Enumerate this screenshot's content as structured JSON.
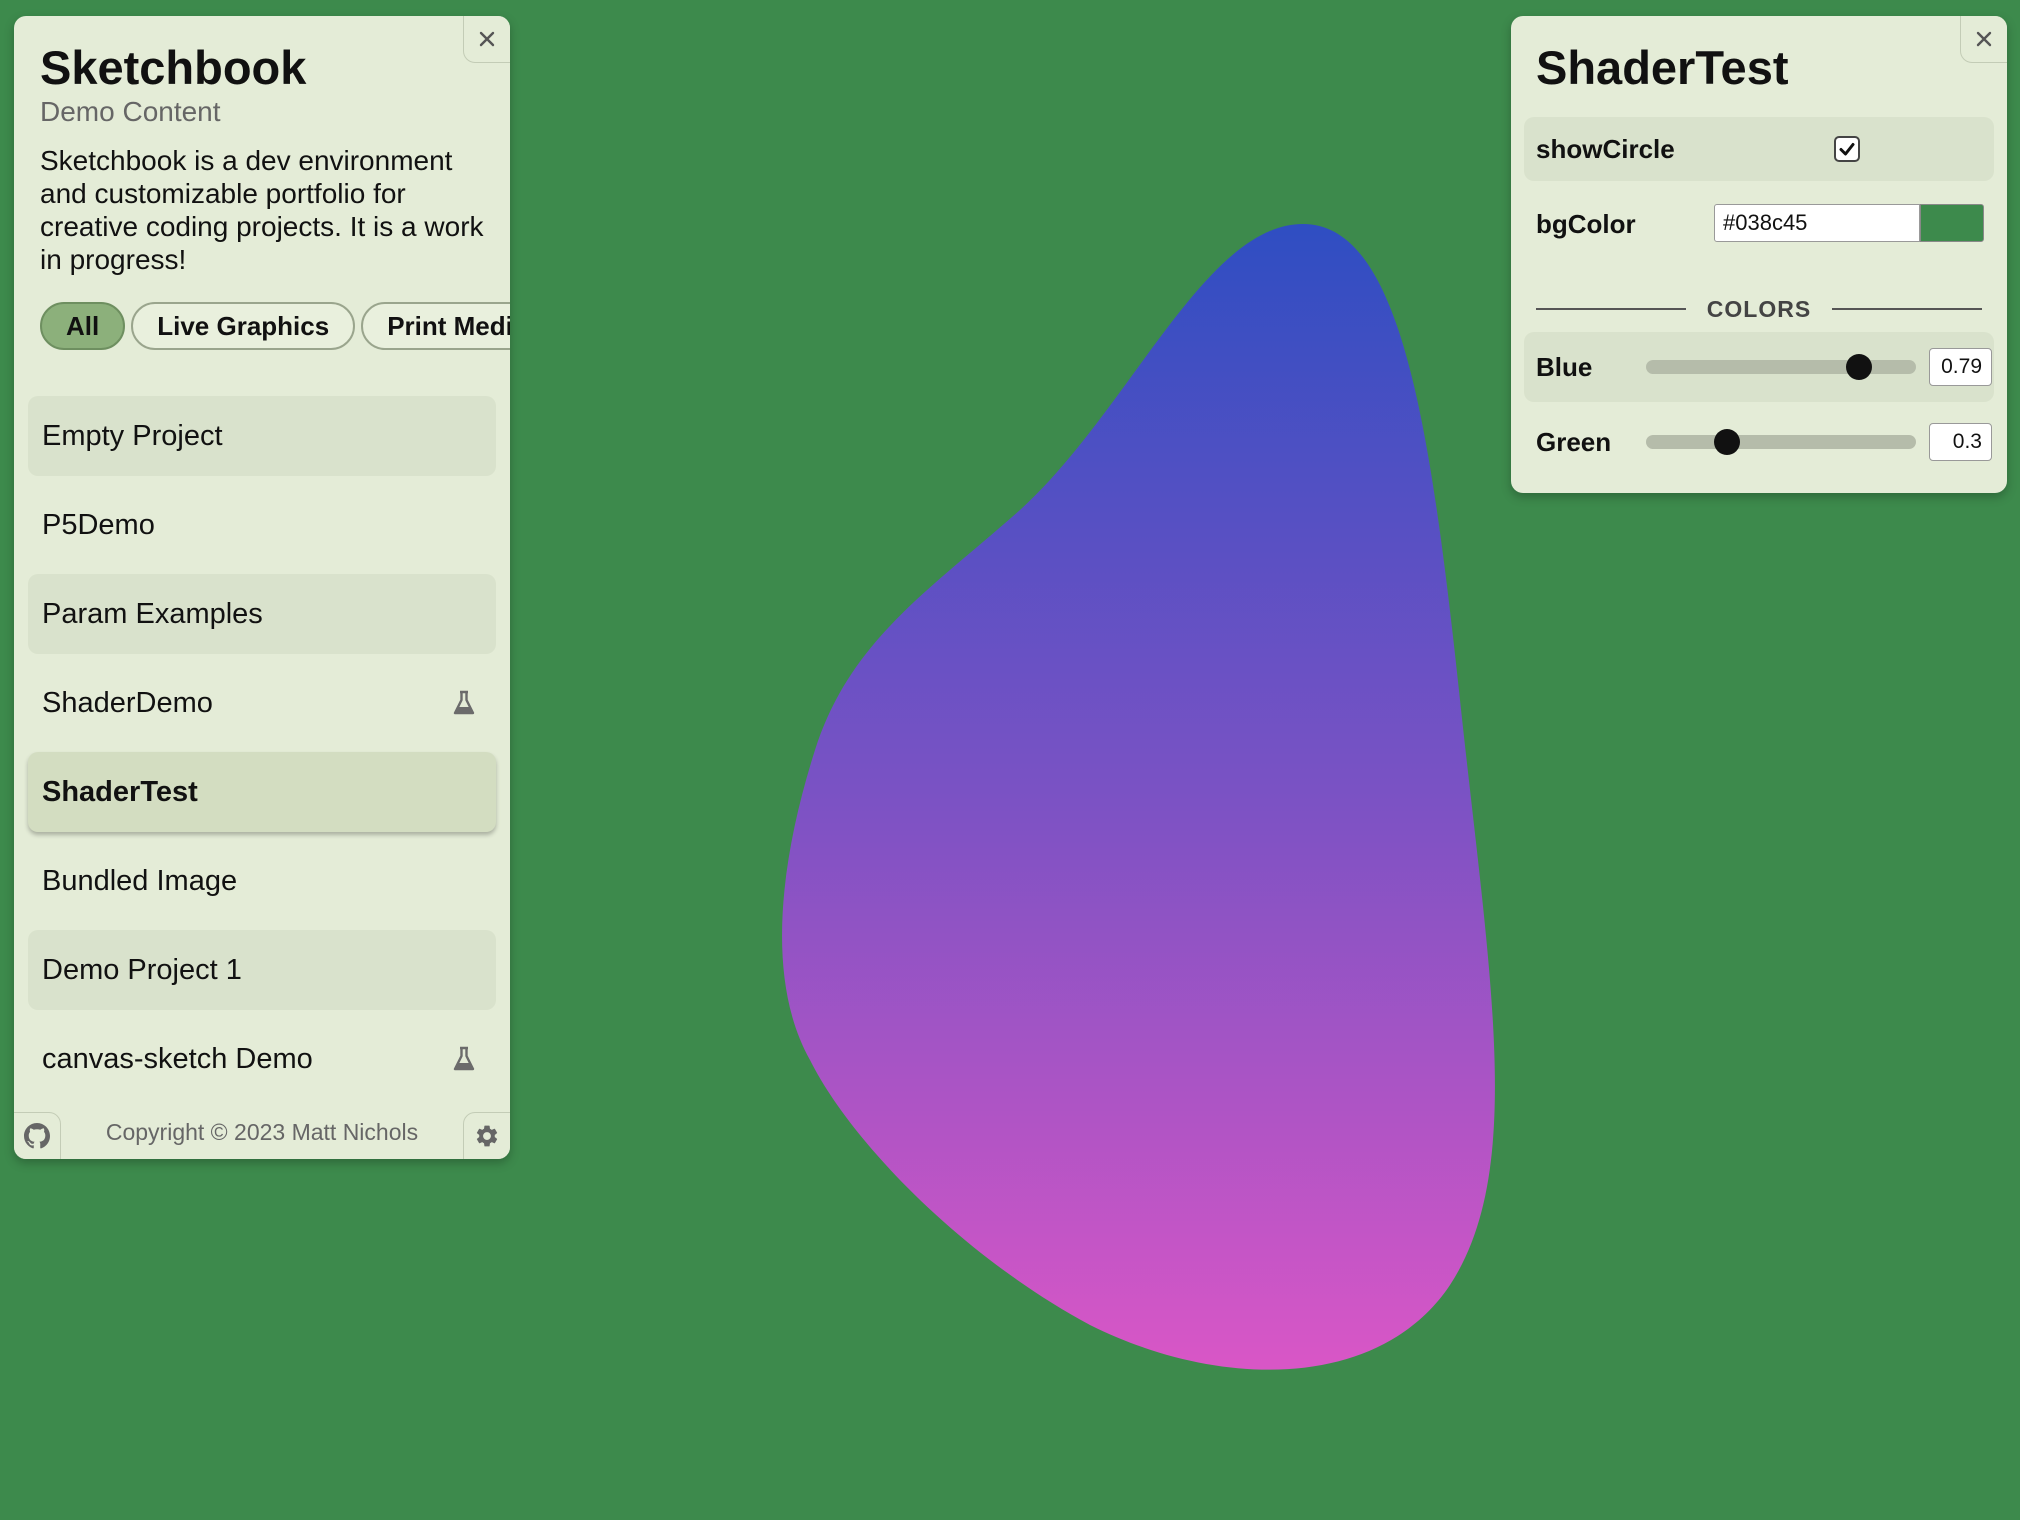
{
  "canvas": {
    "background_color": "#3d8a4c",
    "blob_gradient_top": "#2f4ec2",
    "blob_gradient_mid": "#7b52c4",
    "blob_gradient_bottom": "#d956c6"
  },
  "sidebar": {
    "title": "Sketchbook",
    "subtitle": "Demo Content",
    "description": "Sketchbook is a dev environment and customizable portfolio for creative coding projects. It is a work in progress!",
    "filters": [
      {
        "label": "All",
        "active": true
      },
      {
        "label": "Live Graphics",
        "active": false
      },
      {
        "label": "Print Media",
        "active": false
      }
    ],
    "projects": [
      {
        "label": "Empty Project"
      },
      {
        "label": "P5Demo"
      },
      {
        "label": "Param Examples"
      },
      {
        "label": "ShaderDemo",
        "icon": "flask-icon"
      },
      {
        "label": "ShaderTest",
        "selected": true
      },
      {
        "label": "Bundled Image"
      },
      {
        "label": "Demo Project 1"
      },
      {
        "label": "canvas-sketch Demo",
        "icon": "flask-icon"
      }
    ],
    "copyright": "Copyright © 2023 Matt Nichols",
    "icons": [
      "close-icon",
      "github-icon",
      "gear-icon"
    ]
  },
  "params_panel": {
    "title": "ShaderTest",
    "showCircle": {
      "label": "showCircle",
      "checked": true
    },
    "bgColor": {
      "label": "bgColor",
      "value": "#038c45",
      "swatch": "#3d8a4c"
    },
    "section": "COLORS",
    "sliders": [
      {
        "label": "Blue",
        "value": "0.79",
        "fraction": 0.79
      },
      {
        "label": "Green",
        "value": "0.3",
        "fraction": 0.3
      }
    ]
  }
}
